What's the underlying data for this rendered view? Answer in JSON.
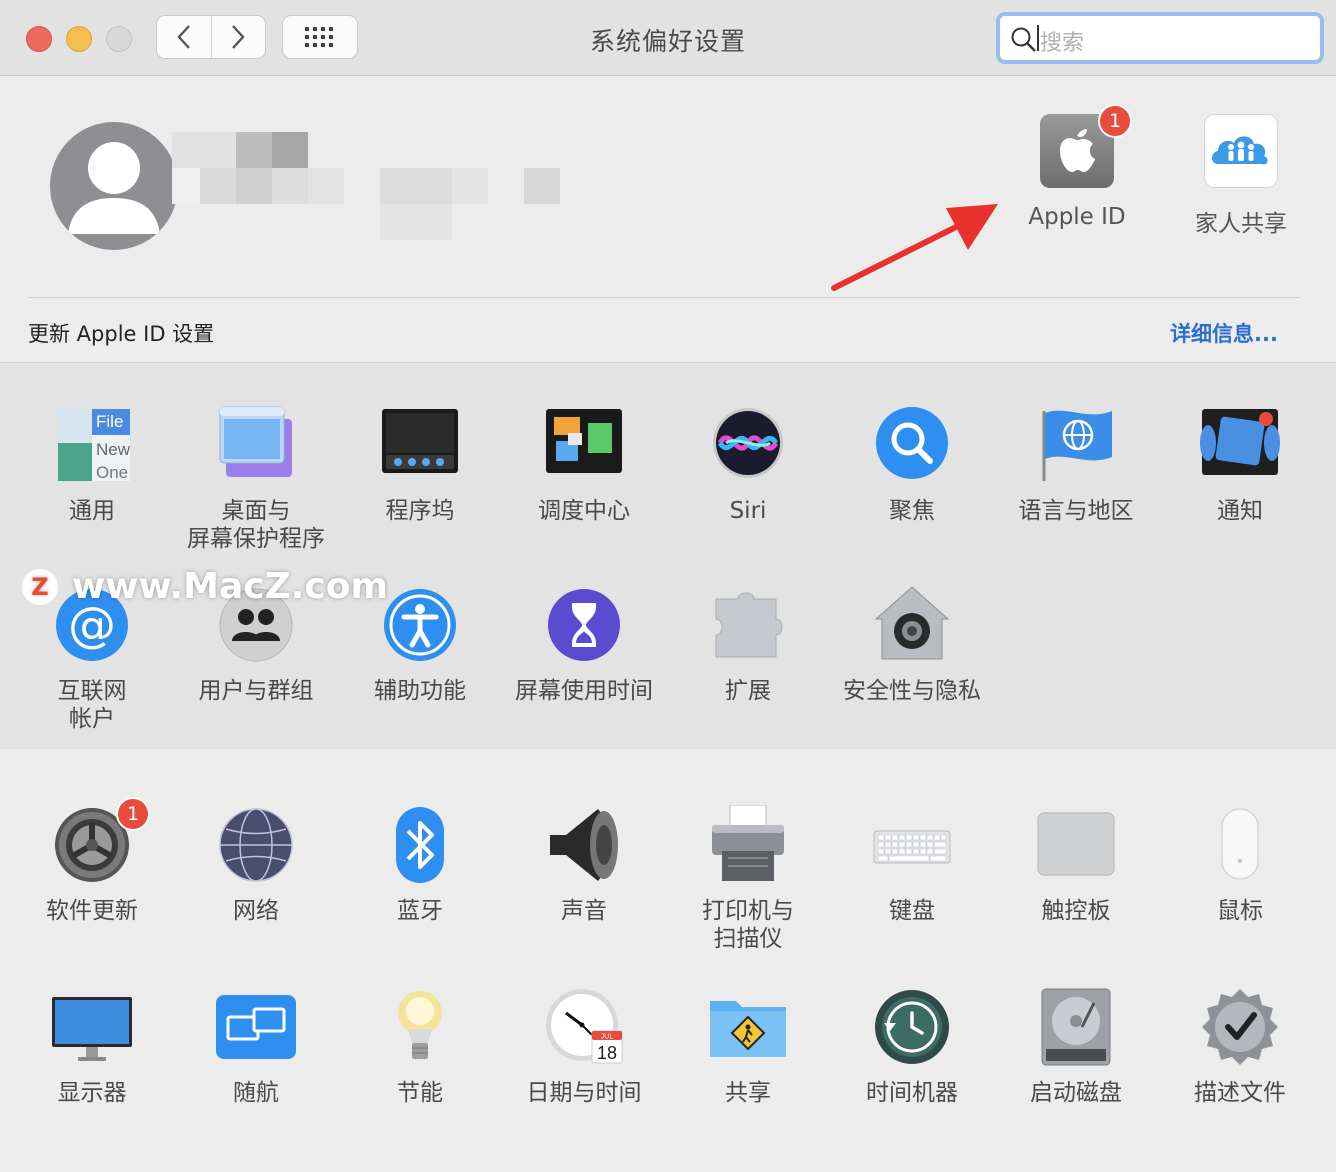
{
  "window": {
    "title": "系统偏好设置"
  },
  "search": {
    "placeholder": "搜索"
  },
  "account": {
    "top_items": [
      {
        "label": "Apple ID",
        "badge": "1"
      },
      {
        "label": "家人共享"
      }
    ],
    "update_text": "更新 Apple ID 设置",
    "details_link": "详细信息..."
  },
  "row1": [
    {
      "label": "通用"
    },
    {
      "label": "桌面与\n屏幕保护程序"
    },
    {
      "label": "程序坞"
    },
    {
      "label": "调度中心"
    },
    {
      "label": "Siri"
    },
    {
      "label": "聚焦"
    },
    {
      "label": "语言与地区"
    },
    {
      "label": "通知"
    }
  ],
  "row2": [
    {
      "label": "互联网\n帐户"
    },
    {
      "label": "用户与群组"
    },
    {
      "label": "辅助功能"
    },
    {
      "label": "屏幕使用时间"
    },
    {
      "label": "扩展"
    },
    {
      "label": "安全性与隐私"
    }
  ],
  "row3": [
    {
      "label": "软件更新",
      "badge": "1"
    },
    {
      "label": "网络"
    },
    {
      "label": "蓝牙"
    },
    {
      "label": "声音"
    },
    {
      "label": "打印机与\n扫描仪"
    },
    {
      "label": "键盘"
    },
    {
      "label": "触控板"
    },
    {
      "label": "鼠标"
    }
  ],
  "row4": [
    {
      "label": "显示器"
    },
    {
      "label": "随航"
    },
    {
      "label": "节能"
    },
    {
      "label": "日期与时间"
    },
    {
      "label": "共享"
    },
    {
      "label": "时间机器"
    },
    {
      "label": "启动磁盘"
    },
    {
      "label": "描述文件"
    }
  ],
  "icon_text": {
    "general_file": "File",
    "general_new": "New",
    "general_one": "One",
    "calendar_month": "JUL",
    "calendar_day": "18"
  },
  "watermark": {
    "z": "Z",
    "text": "www.MacZ.com"
  },
  "colors": {
    "badge": "#e74c3c",
    "link": "#2b6fd1",
    "arrow": "#e8322e"
  }
}
